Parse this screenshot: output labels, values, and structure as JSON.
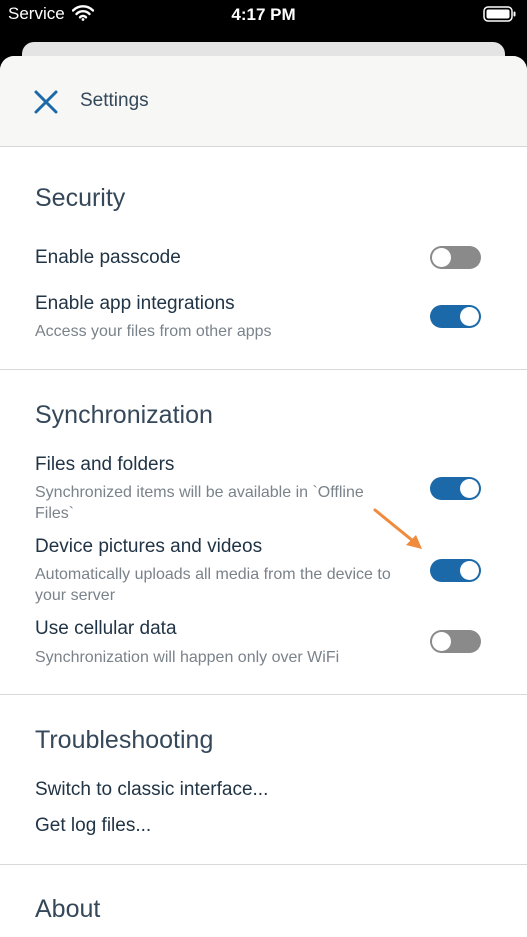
{
  "status_bar": {
    "carrier": "Service",
    "time": "4:17 PM"
  },
  "header": {
    "title": "Settings"
  },
  "security": {
    "title": "Security",
    "items": [
      {
        "title": "Enable passcode",
        "subtitle": "",
        "on": false
      },
      {
        "title": "Enable app integrations",
        "subtitle": "Access your files from other apps",
        "on": true
      }
    ]
  },
  "sync": {
    "title": "Synchronization",
    "items": [
      {
        "title": "Files and folders",
        "subtitle": "Synchronized items will be available in `Offline Files`",
        "on": true
      },
      {
        "title": "Device pictures and videos",
        "subtitle": "Automatically uploads all media from the device to your server",
        "on": true
      },
      {
        "title": "Use cellular data",
        "subtitle": "Synchronization will happen only over WiFi",
        "on": false
      }
    ]
  },
  "troubleshooting": {
    "title": "Troubleshooting",
    "links": [
      "Switch to classic interface...",
      "Get log files..."
    ]
  },
  "about": {
    "title": "About"
  },
  "colors": {
    "accent": "#1b69a8",
    "toggle_off": "#8a8a8a",
    "annotation_arrow": "#f08a3c"
  }
}
